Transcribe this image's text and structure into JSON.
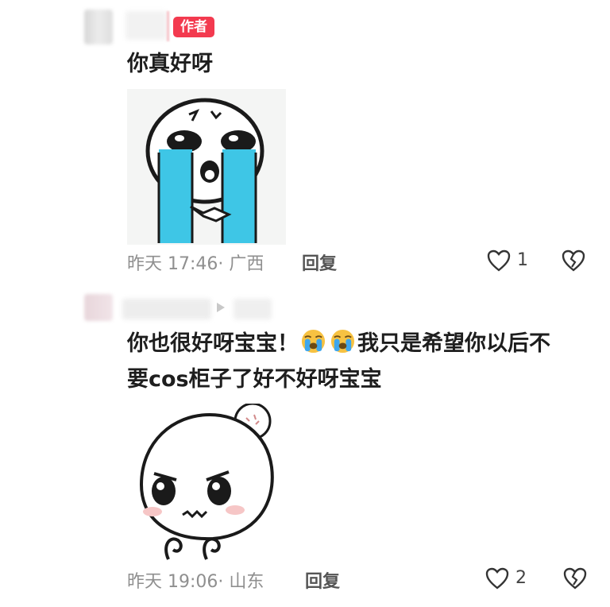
{
  "comment1": {
    "badge": "作者",
    "text": "你真好呀",
    "date": "昨天",
    "time": "17:46",
    "location": "广西",
    "reply_label": "回复",
    "like_count": "1",
    "sticker_icon": "crying-face-sticker"
  },
  "comment2": {
    "text_part1": "你也很好呀宝宝！",
    "emoji_icon": "loudly-crying-face-emoji",
    "text_part2": "我只是希望你以后不",
    "text_line2": "要cos柜子了好不好呀宝宝",
    "date": "昨天",
    "time": "19:06",
    "location": "山东",
    "reply_label": "回复",
    "like_count": "2",
    "sticker_icon": "sad-pouting-face-sticker"
  },
  "colors": {
    "badge_bg": "#f33a4f",
    "meta_text": "#8f8f8f",
    "tear_blue": "#3ec6e6"
  }
}
